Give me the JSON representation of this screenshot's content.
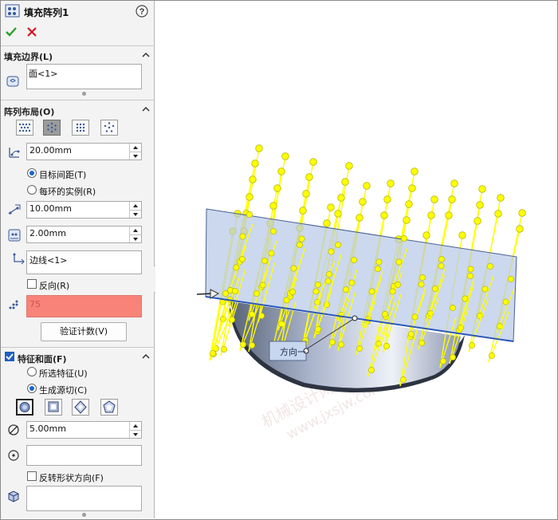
{
  "panel": {
    "title": "填充阵列1",
    "help_icon": "question-circle-icon",
    "ok_icon": "check-icon",
    "cancel_icon": "x-icon"
  },
  "fill_boundary": {
    "title": "填充边界(L)",
    "value": "面<1>"
  },
  "pattern_layout": {
    "title": "阵列布局(O)",
    "layout_buttons": [
      "perforation-layout-icon",
      "circular-layout-icon",
      "square-layout-icon",
      "polygon-layout-icon"
    ],
    "selected_layout": 1,
    "loop_spacing": "20.00mm",
    "radio_target_spacing": "目标间距(T)",
    "radio_instances_per_loop": "每环的实例(R)",
    "instance_spacing": "10.00mm",
    "margin": "2.00mm",
    "direction_value": "边线<1>",
    "reverse_label": "反向(R)",
    "instance_count": "75",
    "verify_button": "验证计数(V)"
  },
  "features_faces": {
    "title": "特征和面(F)",
    "checked": true,
    "radio_selected_features": "所选特征(U)",
    "radio_create_seed_cut": "生成源切(C)",
    "shape_buttons": [
      "circle-shape-icon",
      "square-shape-icon",
      "diamond-shape-icon",
      "polygon-shape-icon"
    ],
    "selected_shape": 0,
    "diameter": "5.00mm",
    "flip_label": "反转形状方向(F)"
  },
  "viewport": {
    "direction_callout": "方向一",
    "watermark_line1": "机械设计网",
    "watermark_line2": "www.jxsjw.com"
  },
  "colors": {
    "accent_blue": "#1f5fbf",
    "instance_count_bg": "#f88379",
    "pattern_yellow": "#ffff00",
    "plate_blue": "#b9c9e8",
    "cancel_red": "#d0181e",
    "ok_green": "#2aa02a"
  }
}
